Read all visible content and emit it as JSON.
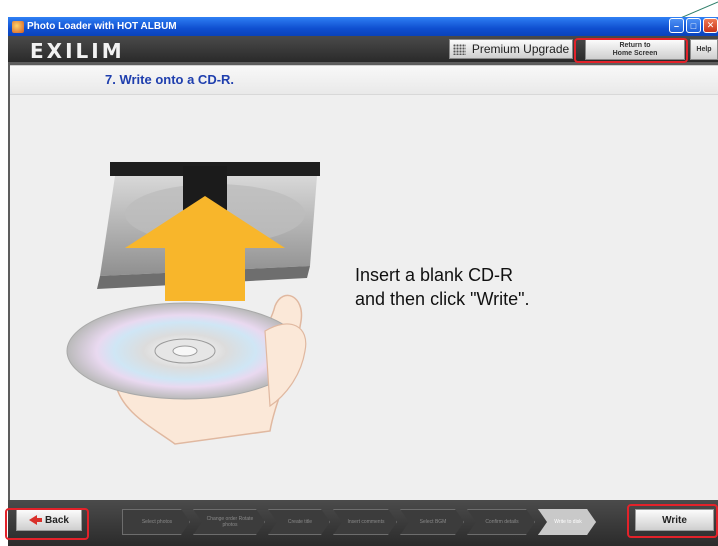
{
  "window": {
    "title": "Photo Loader with HOT ALBUM"
  },
  "header": {
    "logo": "EXILIM",
    "premium_upgrade": "Premium Upgrade",
    "return_home_line1": "Return to",
    "return_home_line2": "Home Screen",
    "help": "Help"
  },
  "step": {
    "title": "7. Write onto a CD-R."
  },
  "instruction": {
    "line1": "Insert a blank CD-R",
    "line2": "and then click \"Write\"."
  },
  "footer": {
    "back": "Back",
    "write": "Write",
    "steps": [
      {
        "label": "Select photos"
      },
      {
        "label": "Change order Rotate photos"
      },
      {
        "label": "Create title"
      },
      {
        "label": "Insert comments"
      },
      {
        "label": "Select BGM"
      },
      {
        "label": "Confirm details"
      },
      {
        "label": "Write to disk"
      }
    ]
  },
  "colors": {
    "highlight": "#e3222a",
    "step_title": "#1f3fae",
    "titlebar": "#0f4fd0",
    "arrow": "#f8b62b"
  }
}
